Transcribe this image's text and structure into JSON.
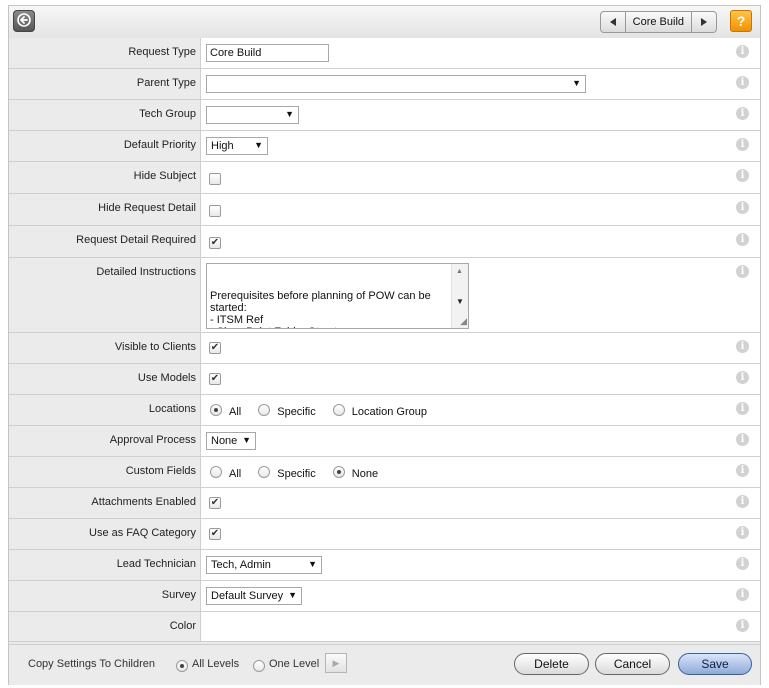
{
  "toolbar": {
    "nav_title": "Core Build",
    "help_label": "?"
  },
  "fields": {
    "request_type": {
      "label": "Request Type",
      "value": "Core Build"
    },
    "parent_type": {
      "label": "Parent Type",
      "value": ""
    },
    "tech_group": {
      "label": "Tech Group",
      "value": ""
    },
    "default_priority": {
      "label": "Default Priority",
      "value": "High"
    },
    "hide_subject": {
      "label": "Hide Subject",
      "checked": false
    },
    "hide_request_detail": {
      "label": "Hide Request Detail",
      "checked": false
    },
    "request_detail_required": {
      "label": "Request Detail Required",
      "checked": true
    },
    "detailed_instructions": {
      "label": "Detailed Instructions",
      "value": "Prerequisites before planning of POW can be started:\n- ITSM Ref\n- SharePoint Folder Structure\n- WBS"
    },
    "visible_to_clients": {
      "label": "Visible to Clients",
      "checked": true
    },
    "use_models": {
      "label": "Use Models",
      "checked": true
    },
    "locations": {
      "label": "Locations",
      "options": [
        "All",
        "Specific",
        "Location Group"
      ],
      "selected": "All"
    },
    "approval_process": {
      "label": "Approval Process",
      "value": "None"
    },
    "custom_fields": {
      "label": "Custom Fields",
      "options": [
        "All",
        "Specific",
        "None"
      ],
      "selected": "None"
    },
    "attachments_enabled": {
      "label": "Attachments Enabled",
      "checked": true
    },
    "use_as_faq_category": {
      "label": "Use as FAQ Category",
      "checked": true
    },
    "lead_technician": {
      "label": "Lead Technician",
      "value": "Tech, Admin"
    },
    "survey": {
      "label": "Survey",
      "value": "Default Survey"
    },
    "color": {
      "label": "Color",
      "value": ""
    }
  },
  "footer": {
    "copy_label": "Copy Settings To Children",
    "copy_options": [
      "All Levels",
      "One Level"
    ],
    "copy_selected": "All Levels",
    "delete_label": "Delete",
    "cancel_label": "Cancel",
    "save_label": "Save"
  },
  "icons": {
    "back": "back-arrow-icon",
    "prev": "triangle-left-icon",
    "next": "triangle-right-icon",
    "help": "question-icon",
    "info": "info-icon",
    "check": "checkmark-icon",
    "dropdown": "chevron-down-icon"
  },
  "colors": {
    "help_button": "#f39200",
    "save_button": "#8fa9d8",
    "label_background": "#ebebeb",
    "border": "#cfcfcf"
  }
}
